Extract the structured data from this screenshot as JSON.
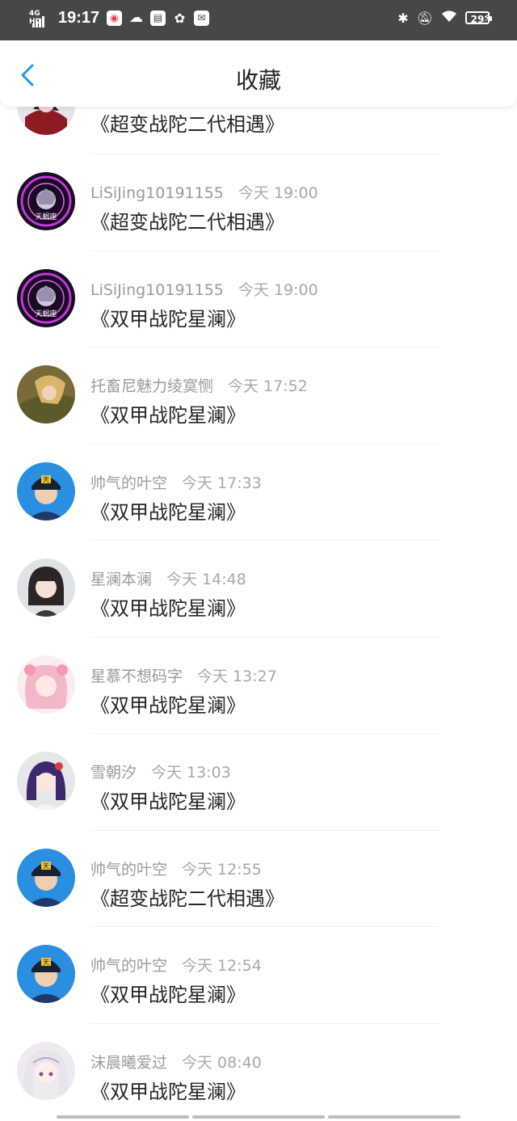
{
  "status_bar": {
    "network": "4G HD",
    "time": "19:17",
    "battery": "29",
    "app_icons": [
      "app-icon",
      "cloud-icon",
      "calendar-icon",
      "wechat-icon",
      "mail-icon"
    ]
  },
  "header": {
    "title": "收藏"
  },
  "items": [
    {
      "user": "",
      "time": "",
      "title": "《超变战陀二代相遇》",
      "avatar": "dark-red-character",
      "partial": true
    },
    {
      "user": "LiSiJing10191155",
      "time": "今天 19:00",
      "title": "《超变战陀二代相遇》",
      "avatar": "purple-emblem"
    },
    {
      "user": "LiSiJing10191155",
      "time": "今天 19:00",
      "title": "《双甲战陀星澜》",
      "avatar": "purple-emblem"
    },
    {
      "user": "托畜尼魅力绫寞恻",
      "time": "今天 17:52",
      "title": "《双甲战陀星澜》",
      "avatar": "girl-in-grass"
    },
    {
      "user": "帅气的叶空",
      "time": "今天 17:33",
      "title": "《双甲战陀星澜》",
      "avatar": "boy-blue-cap"
    },
    {
      "user": "星澜本澜",
      "time": "今天 14:48",
      "title": "《双甲战陀星澜》",
      "avatar": "dark-hair-girl"
    },
    {
      "user": "星慕不想码字",
      "time": "今天 13:27",
      "title": "《双甲战陀星澜》",
      "avatar": "pink-anime-girl"
    },
    {
      "user": "雪朝汐",
      "time": "今天 13:03",
      "title": "《双甲战陀星澜》",
      "avatar": "purple-hair-girl"
    },
    {
      "user": "帅气的叶空",
      "time": "今天 12:55",
      "title": "《超变战陀二代相遇》",
      "avatar": "boy-blue-cap"
    },
    {
      "user": "帅气的叶空",
      "time": "今天 12:54",
      "title": "《双甲战陀星澜》",
      "avatar": "boy-blue-cap"
    },
    {
      "user": "沫晨曦爱过",
      "time": "今天 08:40",
      "title": "《双甲战陀星澜》",
      "avatar": "white-hair-girl"
    }
  ],
  "colors": {
    "status_bar_bg": "#474747",
    "back_accent": "#2196F3",
    "meta_text": "#9b9b9b",
    "title_text": "#262626"
  }
}
